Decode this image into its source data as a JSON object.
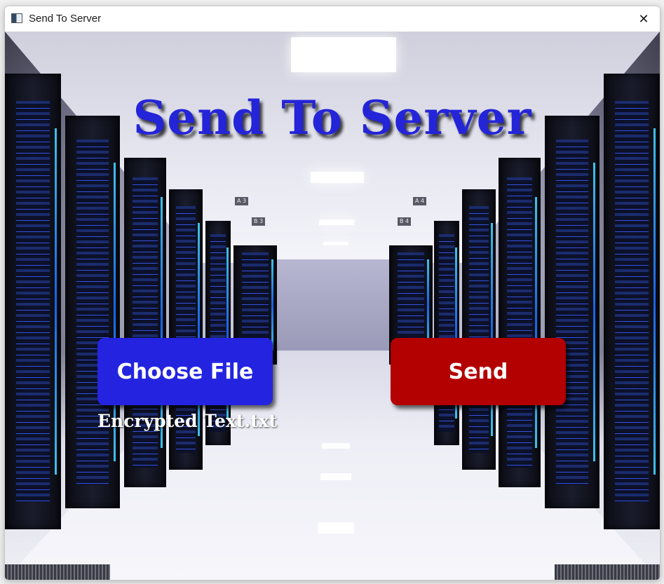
{
  "window": {
    "title": "Send To Server",
    "close_glyph": "✕"
  },
  "main": {
    "headline": "Send To Server",
    "choose_file_label": "Choose File",
    "send_label": "Send",
    "selected_file": "Encrypted Text.txt"
  },
  "background": {
    "aisle_signs": [
      "A 3",
      "B 3",
      "A 4",
      "B 4"
    ]
  },
  "colors": {
    "headline": "#2424d8",
    "choose_button": "#2424e0",
    "send_button": "#b30000",
    "file_label": "#ffffff"
  },
  "icons": {
    "app": "app-window-icon",
    "close": "close-icon"
  }
}
